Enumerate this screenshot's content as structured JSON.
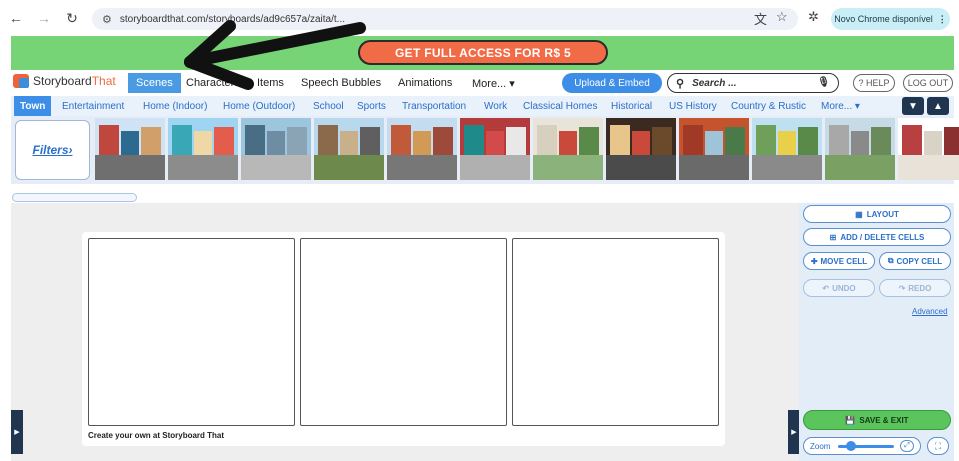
{
  "browser": {
    "url": "storyboardthat.com/storyboards/ad9c657a/zaita/t...",
    "update_pill": "Novo Chrome disponível"
  },
  "banner": {
    "cta": "GET FULL ACCESS FOR R$ 5"
  },
  "logo": {
    "story": "Storyboard",
    "that": "That"
  },
  "topnav": {
    "items": [
      "Scenes",
      "Characters",
      "Items",
      "Speech Bubbles",
      "Animations",
      "More... ▾"
    ],
    "upload": "Upload & Embed",
    "search_placeholder": "Search ...",
    "help": "? HELP",
    "logout": "LOG OUT"
  },
  "categories": [
    "Town",
    "Entertainment",
    "Home (Indoor)",
    "Home (Outdoor)",
    "School",
    "Sports",
    "Transportation",
    "Work",
    "Classical Homes",
    "Historical",
    "US History",
    "Country & Rustic",
    "More... ▾"
  ],
  "filters": "Filters›",
  "thumbnails": [
    {
      "name": "row-houses",
      "sky": "#cfe3f4",
      "ground": "#6f6f6f",
      "b1": "#c0473e",
      "b2": "#2d6a8f",
      "b3": "#d1a06a"
    },
    {
      "name": "shops",
      "sky": "#9fd4f2",
      "ground": "#8c8c8c",
      "b1": "#3aa7b7",
      "b2": "#f0d7a6",
      "b3": "#e45c4b"
    },
    {
      "name": "city-skyline",
      "sky": "#9cc6de",
      "ground": "#b8b8b8",
      "b1": "#4a6d86",
      "b2": "#6e8da3",
      "b3": "#8aa4b6"
    },
    {
      "name": "plaza",
      "sky": "#b8d8ee",
      "ground": "#6d8a4c",
      "b1": "#8a6a4a",
      "b2": "#c9b08a",
      "b3": "#5f5f5f"
    },
    {
      "name": "street",
      "sky": "#c4dcef",
      "ground": "#777777",
      "b1": "#c05a3a",
      "b2": "#d39a55",
      "b3": "#9e4a3a"
    },
    {
      "name": "red-building",
      "sky": "#b33b3b",
      "ground": "#b0b0b0",
      "b1": "#1f8a8a",
      "b2": "#d24a4a",
      "b3": "#e8e8e8"
    },
    {
      "name": "patio",
      "sky": "#e9e4d9",
      "ground": "#8bb27a",
      "b1": "#d8d0bf",
      "b2": "#c94a3a",
      "b3": "#5a8a4a"
    },
    {
      "name": "store-front",
      "sky": "#3a2a1f",
      "ground": "#4b4b4b",
      "b1": "#e8c58a",
      "b2": "#c94a3a",
      "b3": "#6a4a2a"
    },
    {
      "name": "alley",
      "sky": "#c4532e",
      "ground": "#6a6a6a",
      "b1": "#a03a26",
      "b2": "#9fc4d8",
      "b3": "#4a7a4a"
    },
    {
      "name": "parking-lot",
      "sky": "#bfe0f0",
      "ground": "#8a8a8a",
      "b1": "#6fa05a",
      "b2": "#e8d04a",
      "b3": "#5a8a4a"
    },
    {
      "name": "cemetery",
      "sky": "#c7dbe6",
      "ground": "#7aa064",
      "b1": "#a8a8a8",
      "b2": "#8a8a8a",
      "b3": "#6a8a5a"
    },
    {
      "name": "diner",
      "sky": "#ffffff",
      "ground": "#e8e2d8",
      "b1": "#b84040",
      "b2": "#d9d2c6",
      "b3": "#8a3030"
    }
  ],
  "panel": {
    "layout": "LAYOUT",
    "add_delete": "ADD / DELETE CELLS",
    "move": "MOVE CELL",
    "copy": "COPY CELL",
    "undo": "UNDO",
    "redo": "REDO",
    "advanced": "Advanced",
    "save": "SAVE & EXIT",
    "zoom": "Zoom"
  },
  "board": {
    "caption": "Create your own at Storyboard That",
    "cells": 3
  },
  "colors": {
    "banner": "#76d476",
    "cta": "#f26b47",
    "accent": "#3d8ee6"
  }
}
